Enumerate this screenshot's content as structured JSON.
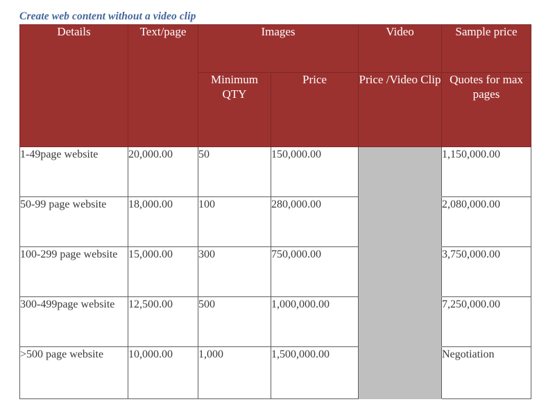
{
  "title": "Create web content without a video clip",
  "colors": {
    "header_bg": "#9c3230",
    "header_text": "#ffffff",
    "title_text": "#42659a",
    "body_text": "#3a3a3a",
    "disabled_cell_bg": "#bfbfbf",
    "border": "#5e5e5e",
    "page_bg": "#ffffff"
  },
  "table": {
    "header": {
      "details": "Details",
      "text_per_page": "Text/page",
      "images_group": "Images",
      "video_group": "Video",
      "sample_price_group": "Sample price",
      "minimum_qty": "Minimum QTY",
      "price": "Price",
      "price_per_video_clip": "Price /Video Clip",
      "quotes_for_max_pages": "Quotes for max pages"
    },
    "rows": [
      {
        "details": "1-49page website",
        "text_per_page": "20,000.00",
        "minimum_qty": "50",
        "price": "150,000.00",
        "price_per_video_clip": "",
        "quotes_for_max_pages": "1,150,000.00"
      },
      {
        "details": "50-99 page website",
        "text_per_page": "18,000.00",
        "minimum_qty": "100",
        "price": "280,000.00",
        "price_per_video_clip": "",
        "quotes_for_max_pages": "2,080,000.00"
      },
      {
        "details": "100-299 page website",
        "text_per_page": "15,000.00",
        "minimum_qty": "300",
        "price": "750,000.00",
        "price_per_video_clip": "",
        "quotes_for_max_pages": "3,750,000.00"
      },
      {
        "details": "300-499page website",
        "text_per_page": "12,500.00",
        "minimum_qty": "500",
        "price": "1,000,000.00",
        "price_per_video_clip": "",
        "quotes_for_max_pages": "7,250,000.00"
      },
      {
        "details": ">500 page website",
        "text_per_page": "10,000.00",
        "minimum_qty": "1,000",
        "price": "1,500,000.00",
        "price_per_video_clip": "",
        "quotes_for_max_pages": "Negotiation"
      }
    ]
  }
}
